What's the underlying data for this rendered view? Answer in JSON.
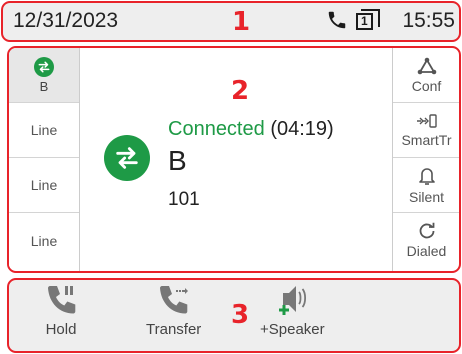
{
  "status_bar": {
    "date": "12/31/2023",
    "time": "15:55",
    "account_badge": "1",
    "icons": [
      "phone-icon",
      "account-register-icon"
    ]
  },
  "callouts": {
    "c1": "1",
    "c2": "2",
    "c3": "3"
  },
  "line_keys": [
    {
      "label": "B",
      "icon": "transfer-arrows-icon",
      "active": true
    },
    {
      "label": "Line"
    },
    {
      "label": "Line"
    },
    {
      "label": "Line"
    }
  ],
  "call": {
    "status": "Connected",
    "duration": "(04:19)",
    "name": "B",
    "number": "101",
    "avatar_icon": "transfer-arrows-icon"
  },
  "function_keys": [
    {
      "label": "Conf",
      "icon": "conference-icon"
    },
    {
      "label": "SmartTr",
      "icon": "smart-transfer-icon"
    },
    {
      "label": "Silent",
      "icon": "bell-icon"
    },
    {
      "label": "Dialed",
      "icon": "redial-icon"
    }
  ],
  "softkeys": [
    {
      "label": "Hold",
      "icon": "hold-icon"
    },
    {
      "label": "Transfer",
      "icon": "transfer-icon"
    },
    {
      "label": "+Speaker",
      "icon": "speaker-add-icon"
    }
  ],
  "colors": {
    "accent_green": "#1e9a46",
    "callout_red": "#e8232a",
    "panel_gray": "#eeeeee"
  }
}
